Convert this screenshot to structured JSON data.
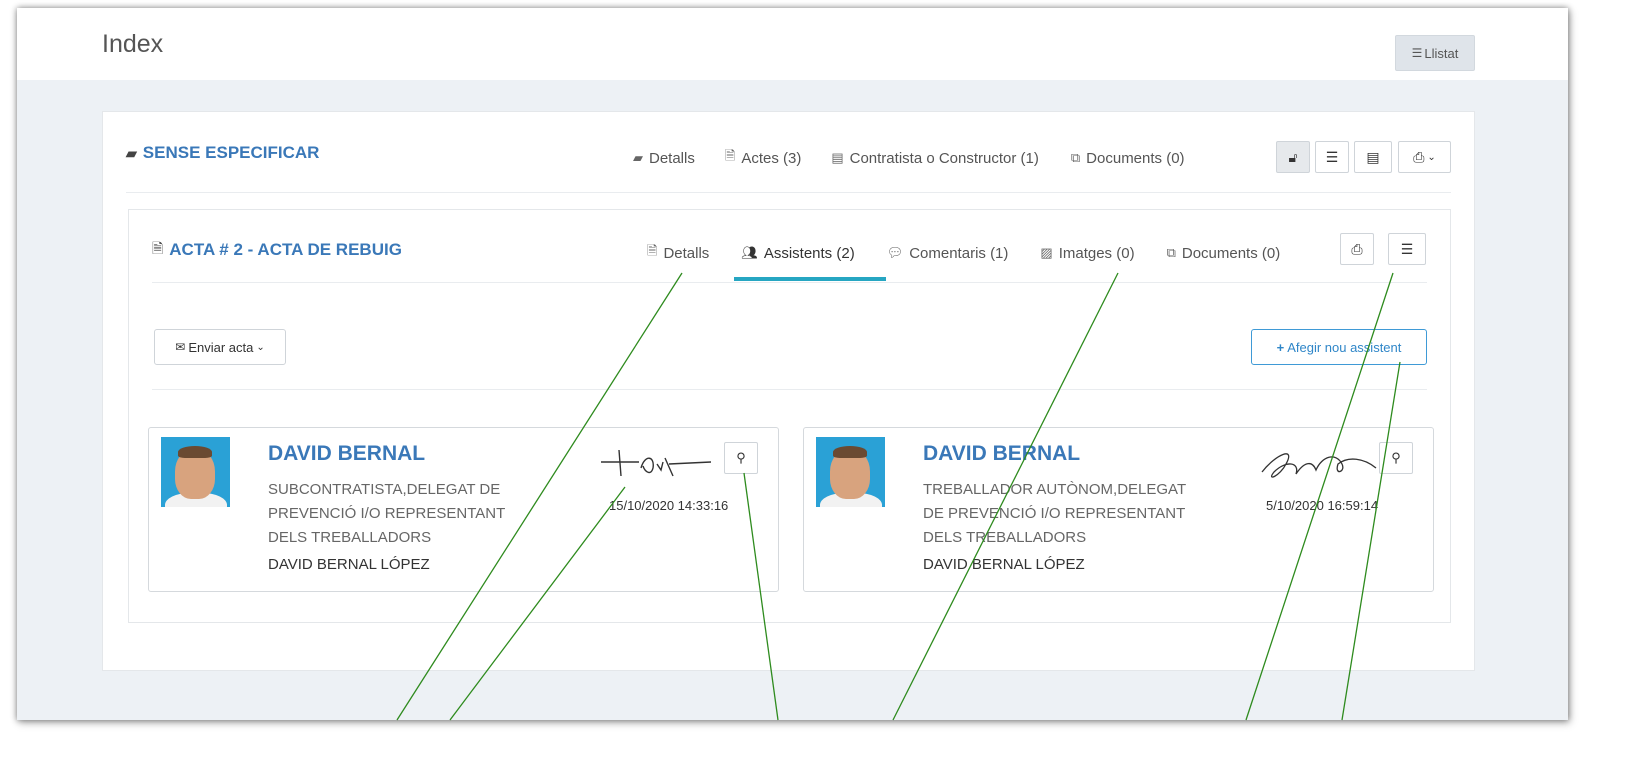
{
  "header": {
    "title": "Index",
    "list_button": "Llistat",
    "list_icon": "list-icon"
  },
  "project": {
    "title": "SENSE ESPECIFICAR",
    "icon": "book-icon",
    "tabs": [
      {
        "label": "Detalls",
        "icon": "book-icon"
      },
      {
        "label": "Actes (3)",
        "icon": "file-icon"
      },
      {
        "label": "Contratista o Constructor (1)",
        "icon": "id-card-icon"
      },
      {
        "label": "Documents (0)",
        "icon": "copy-icon"
      }
    ],
    "actions": [
      "unlock-icon",
      "list-icon",
      "id-card-icon",
      "print-icon"
    ]
  },
  "acta": {
    "title": "ACTA # 2 - ACTA DE REBUIG",
    "icon": "file-icon",
    "tabs": [
      {
        "label": "Detalls",
        "icon": "file-icon"
      },
      {
        "label": "Assistents (2)",
        "icon": "users-icon",
        "active": true
      },
      {
        "label": "Comentaris (1)",
        "icon": "comment-icon"
      },
      {
        "label": "Imatges (0)",
        "icon": "image-icon"
      },
      {
        "label": "Documents (0)",
        "icon": "copy-icon"
      }
    ],
    "actions": [
      "print-icon",
      "list-icon"
    ],
    "send_button": "Enviar acta",
    "add_button": "Afegir nou assistent"
  },
  "attendees": [
    {
      "name": "DAVID BERNAL",
      "role": "SUBCONTRATISTA,DELEGAT DE PREVENCIÓ I/O REPRESENTANT DELS TREBALLADORS",
      "full_name": "DAVID BERNAL LÓPEZ",
      "datetime": "15/10/2020 14:33:16"
    },
    {
      "name": "DAVID BERNAL",
      "role": "TREBALLADOR AUTÒNOM,DELEGAT DE PREVENCIÓ I/O REPRESENTANT DELS TREBALLADORS",
      "full_name": "DAVID BERNAL LÓPEZ",
      "datetime": "5/10/2020 16:59:14"
    }
  ],
  "colors": {
    "accent": "#3a78b8",
    "tab_underline": "#26a6c2",
    "annotation_line": "#2e8b1e",
    "background": "#edf1f5"
  }
}
